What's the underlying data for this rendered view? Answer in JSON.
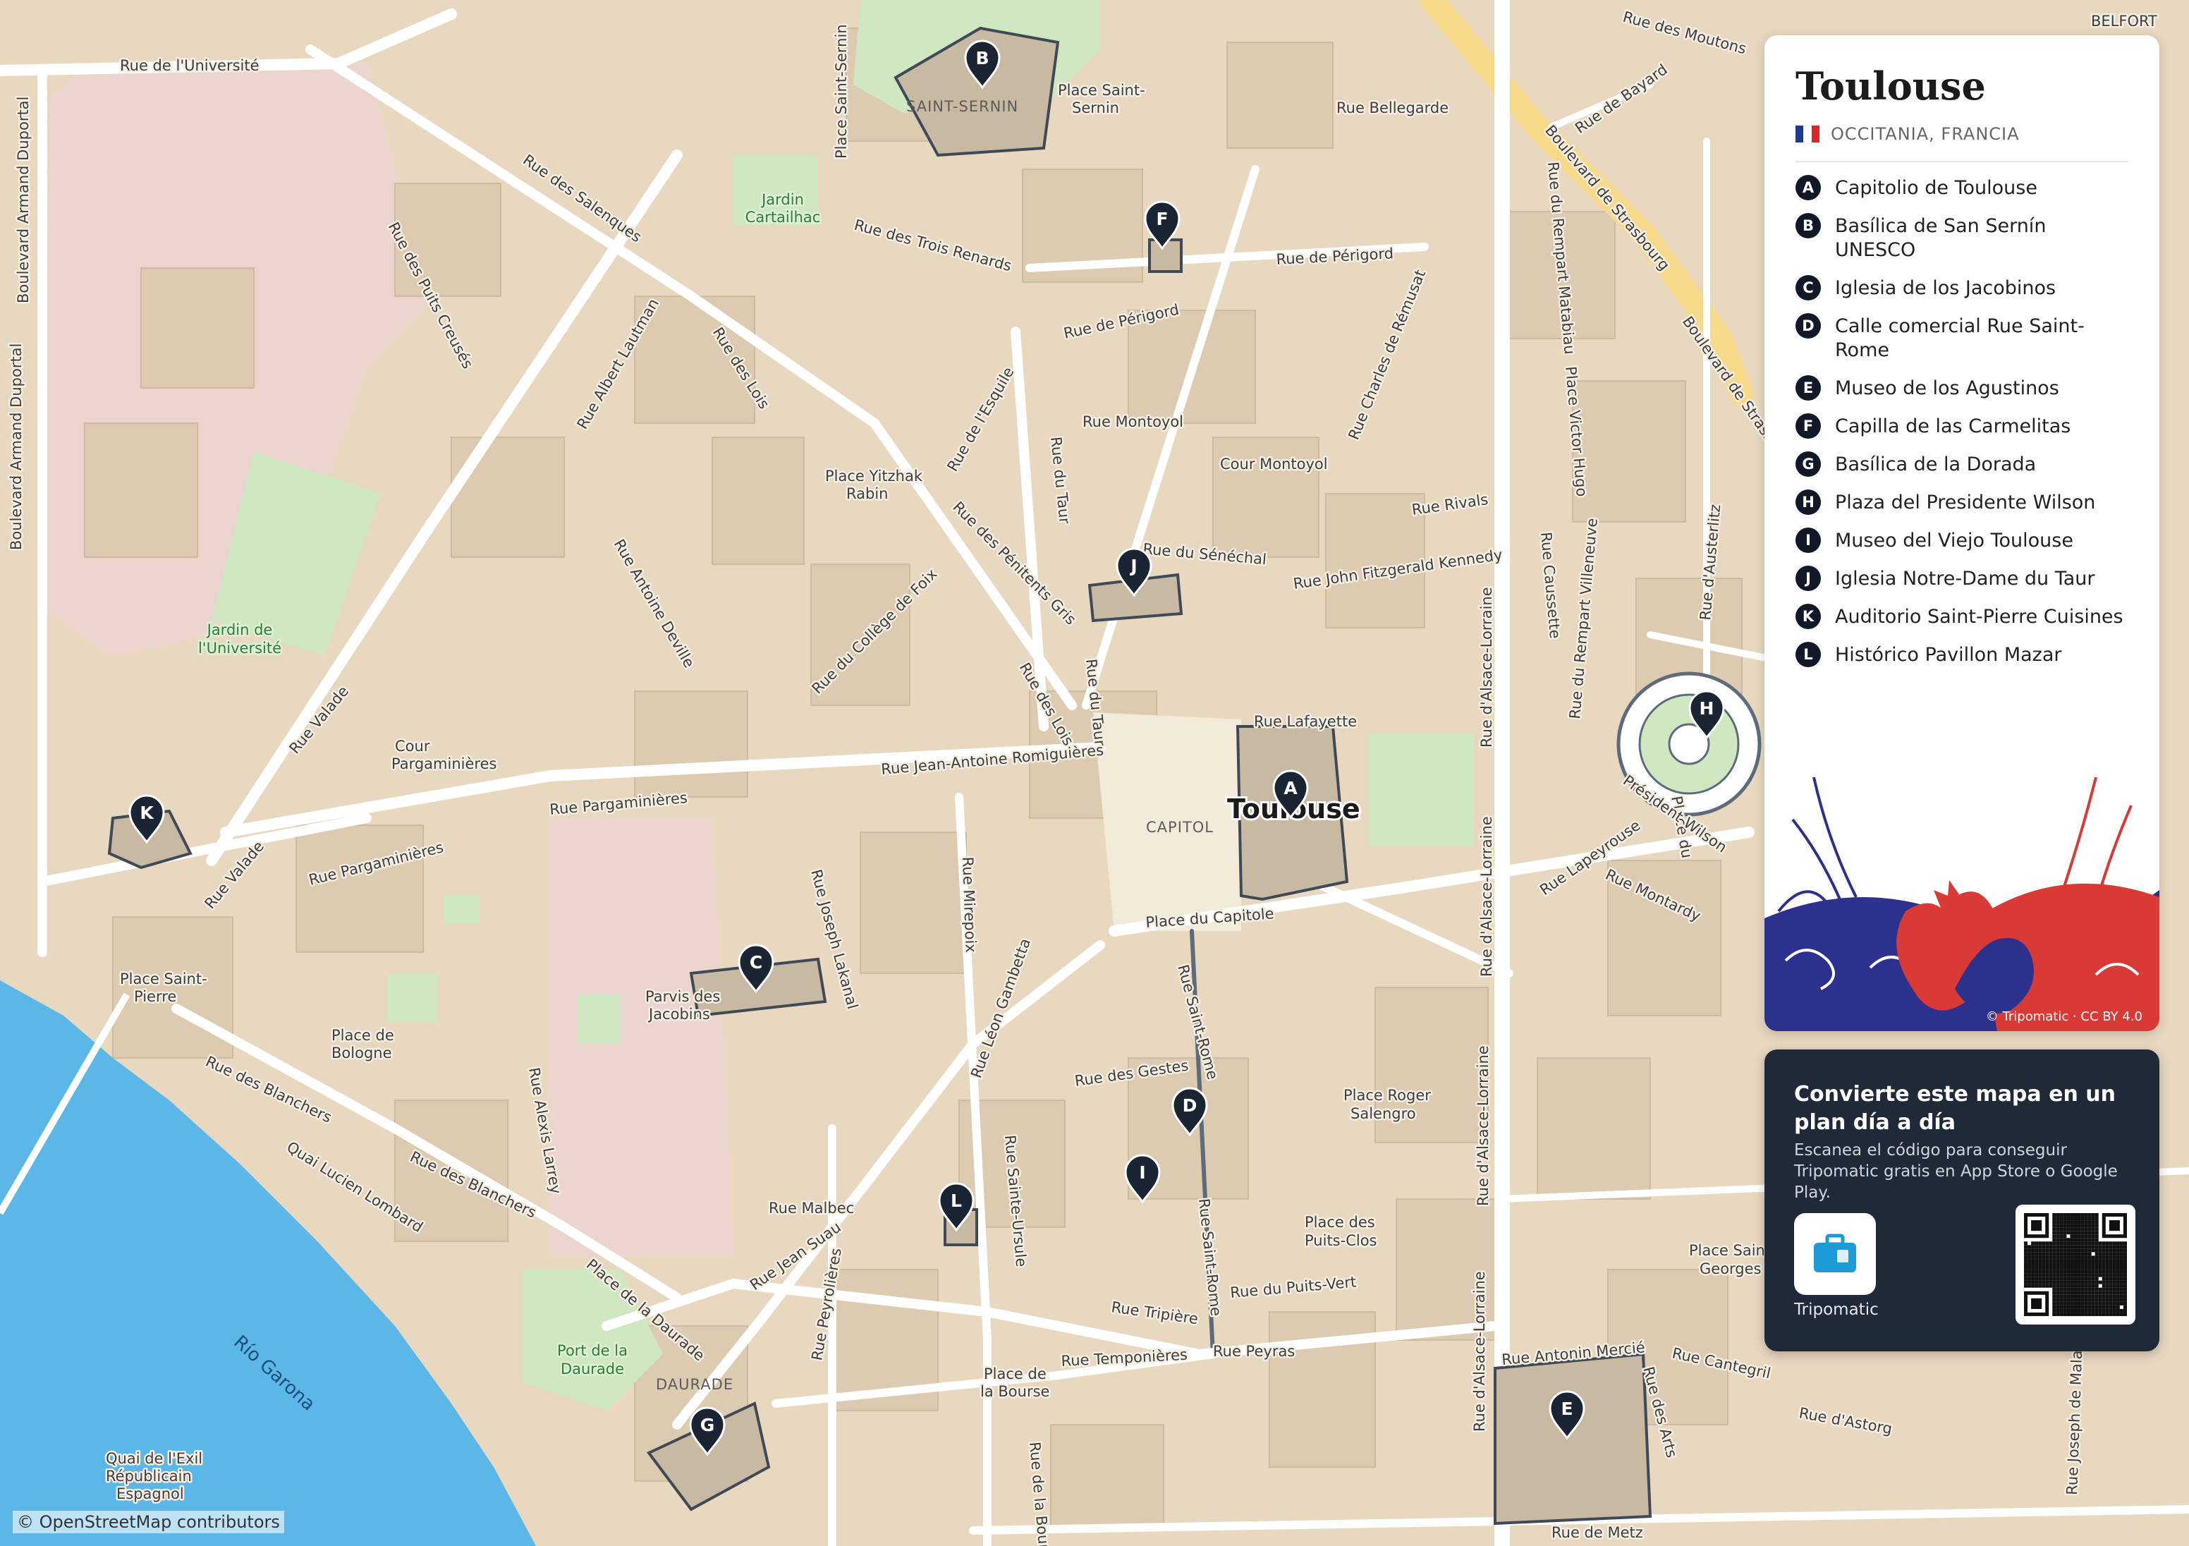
{
  "map": {
    "attribution": "© OpenStreetMap contributors",
    "city_label": "Toulouse",
    "districts": [
      "SAINT-SERNIN",
      "CAPITOL",
      "DAURADE"
    ],
    "river": "Río Garona",
    "streets": [
      "Rue de l'Université",
      "Boulevard Armand Duportal",
      "Rue des Salenques",
      "Rue des Puits Creusés",
      "Rue Albert Lautman",
      "Rue des Lois",
      "Rue des Trois Renards",
      "Rue de Périgord",
      "Rue Bellegarde",
      "Place Saint-Sernin",
      "Rue Montoyol",
      "Rue du Taur",
      "Rue de l'Esquile",
      "Place Yitzhak Rabin",
      "Rue des Pénitents Gris",
      "Rue Antoine Deville",
      "Rue du Collège de Foix",
      "Rue du Sénéchal",
      "Rue John Fitzgerald Kennedy",
      "Rue Charles de Rémusat",
      "Rue Rivals",
      "Cour Montoyol",
      "Rue Lafayette",
      "Rue Jean-Antoine Romiguières",
      "Rue Pargaminières",
      "Rue Valade",
      "Place du Capitole",
      "Rue Mirepoix",
      "Rue Joseph Lakanal",
      "Rue Léon Gambetta",
      "Rue des Gestes",
      "Rue Saint-Rome",
      "Rue Sainte-Ursule",
      "Rue Malbec",
      "Rue Jean Suau",
      "Rue Peyrolières",
      "Rue Tripière",
      "Rue du Puits-Vert",
      "Rue Temponières",
      "Rue Peyras",
      "Place de la Bourse",
      "Rue de la Bourse",
      "Rue des Blanchers",
      "Quai Lucien Lombard",
      "Place de la Daurade",
      "Rue Alexis Larrey",
      "Place de Bologne",
      "Rue d'Alsace-Lorraine",
      "Rue Antonin Mercié",
      "Rue des Arts",
      "Rue de Metz",
      "Boulevard de Strasbourg",
      "Rue de Bayard",
      "Rue du Rempart Matabiau",
      "Place Victor Hugo",
      "Rue Caussette",
      "Rue du Rempart Villeneuve",
      "Rue d'Austerlitz",
      "Rue Lapeyrouse",
      "Rue Montardy",
      "Rue Cantegril",
      "Rue d'Astorg",
      "Rue Joseph de Malaret",
      "Place Roger Salengro",
      "Place des Puits-Clos",
      "Place Saint-Georges",
      "Place Saint-Pierre",
      "Parvis des Jacobins",
      "Cour Pargaminières",
      "Quai de l'Exil Républicain Espagnol",
      "Place du Président Wilson",
      "Rue des Moutons",
      "BELFORT"
    ],
    "greens": [
      "Jardin Cartailhac",
      "Jardin de l'Université",
      "Port de la Daurade"
    ],
    "markers": [
      "A",
      "B",
      "C",
      "D",
      "E",
      "F",
      "G",
      "H",
      "I",
      "J",
      "K",
      "L"
    ]
  },
  "panel": {
    "title": "Toulouse",
    "region": "OCCITANIA, FRANCIA",
    "flag_colors": [
      "#1e3a8a",
      "#ffffff",
      "#dc2626"
    ],
    "legend": [
      {
        "letter": "A",
        "label": "Capitolio de Toulouse"
      },
      {
        "letter": "B",
        "label": "Basílica de San Sernín UNESCO"
      },
      {
        "letter": "C",
        "label": "Iglesia de los Jacobinos"
      },
      {
        "letter": "D",
        "label": "Calle comercial Rue Saint-Rome"
      },
      {
        "letter": "E",
        "label": "Museo de los Agustinos"
      },
      {
        "letter": "F",
        "label": "Capilla de las Carmelitas"
      },
      {
        "letter": "G",
        "label": "Basílica de la Dorada"
      },
      {
        "letter": "H",
        "label": "Plaza del Presidente Wilson"
      },
      {
        "letter": "I",
        "label": "Museo del Viejo Toulouse"
      },
      {
        "letter": "J",
        "label": "Iglesia Notre-Dame du Taur"
      },
      {
        "letter": "K",
        "label": "Auditorio Saint-Pierre Cuisines"
      },
      {
        "letter": "L",
        "label": "Histórico Pavillon Mazar"
      }
    ],
    "art_credit": "© Tripomatic · CC BY 4.0"
  },
  "promo": {
    "title": "Convierte este mapa en un plan día a día",
    "text": "Escanea el código para conseguir Tripomatic gratis en App Store o Google Play.",
    "app_name": "Tripomatic",
    "accent": "#1d9bd7"
  }
}
